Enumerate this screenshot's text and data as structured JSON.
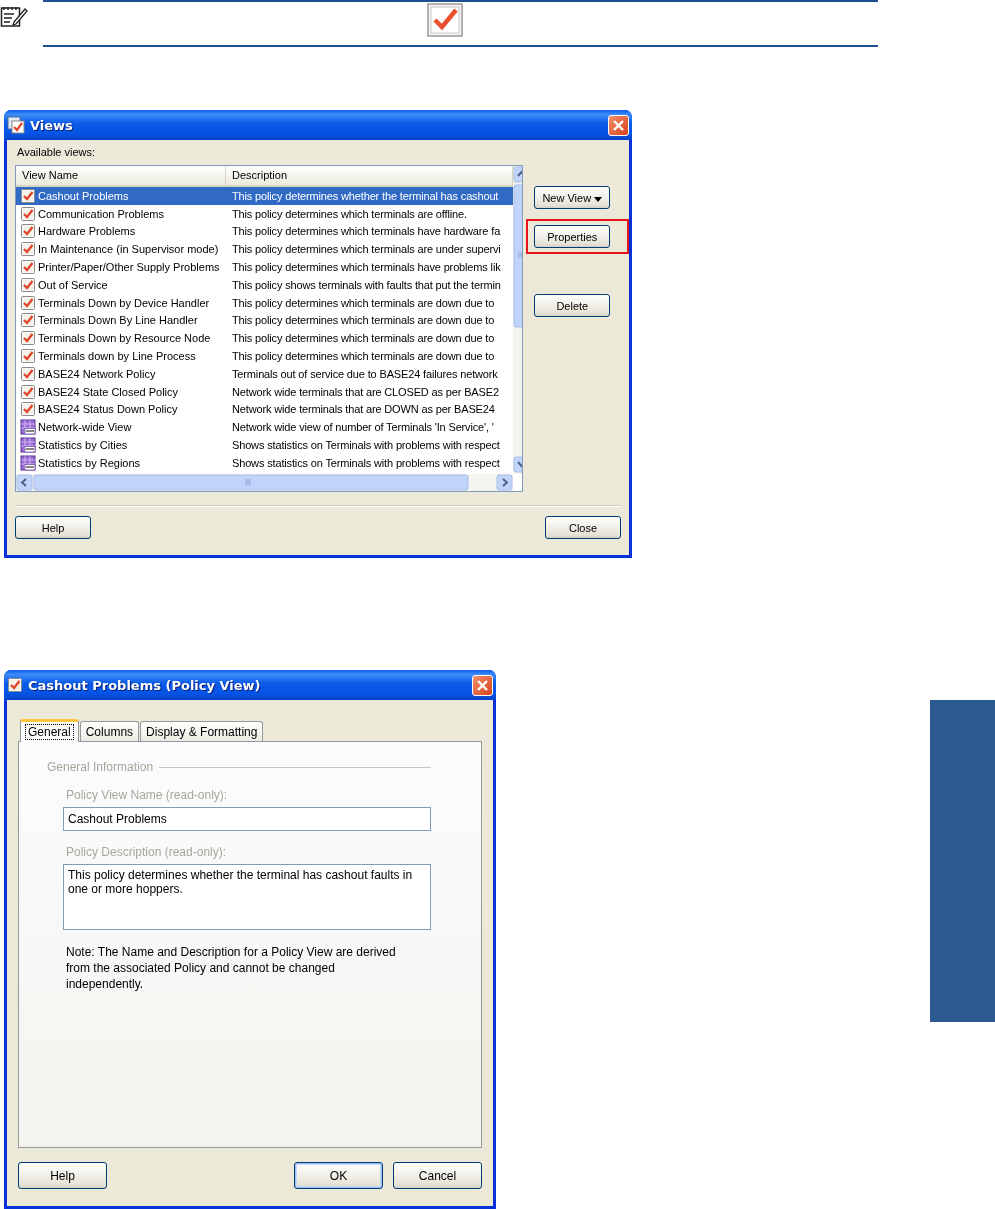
{
  "views_dialog": {
    "title": "Views",
    "list_label": "Available views:",
    "columns": [
      "View Name",
      "Description"
    ],
    "rows": [
      {
        "name": "Cashout Problems",
        "description": "This policy determines whether the terminal has cashout",
        "kind": "policy",
        "selected": true
      },
      {
        "name": "Communication Problems",
        "description": "This policy determines which terminals are offline.",
        "kind": "policy",
        "selected": false
      },
      {
        "name": "Hardware Problems",
        "description": "This policy determines which terminals have hardware fa",
        "kind": "policy",
        "selected": false
      },
      {
        "name": "In Maintenance (in Supervisor mode)",
        "description": "This policy determines which terminals are under supervi",
        "kind": "policy",
        "selected": false
      },
      {
        "name": "Printer/Paper/Other Supply Problems",
        "description": "This policy determines which terminals have problems lik",
        "kind": "policy",
        "selected": false
      },
      {
        "name": "Out of Service",
        "description": "This policy shows terminals with faults that put the termin",
        "kind": "policy",
        "selected": false
      },
      {
        "name": "Terminals Down by Device Handler",
        "description": "This policy determines which terminals are down due to",
        "kind": "policy",
        "selected": false
      },
      {
        "name": "Terminals Down By Line Handler",
        "description": "This policy determines which terminals are down due to",
        "kind": "policy",
        "selected": false
      },
      {
        "name": "Terminals Down by Resource Node",
        "description": "This policy determines which terminals are down due to",
        "kind": "policy",
        "selected": false
      },
      {
        "name": "Terminals down by Line Process",
        "description": "This policy determines which terminals are down due to",
        "kind": "policy",
        "selected": false
      },
      {
        "name": "BASE24 Network Policy",
        "description": "Terminals out of service due to BASE24 failures network",
        "kind": "policy",
        "selected": false
      },
      {
        "name": "BASE24 State Closed Policy",
        "description": "Network wide terminals that are CLOSED as per BASE2",
        "kind": "policy",
        "selected": false
      },
      {
        "name": "BASE24 Status Down Policy",
        "description": "Network wide terminals that are DOWN as per BASE24",
        "kind": "policy",
        "selected": false
      },
      {
        "name": "Network-wide View",
        "description": "Network wide view of number of Terminals 'In Service', '",
        "kind": "sql",
        "selected": false
      },
      {
        "name": "Statistics by Cities",
        "description": "Shows statistics on Terminals with problems with respect",
        "kind": "sql",
        "selected": false
      },
      {
        "name": "Statistics by Regions",
        "description": "Shows statistics on Terminals with problems with respect",
        "kind": "sql",
        "selected": false
      }
    ],
    "side_buttons": [
      {
        "label": "New View",
        "kind": "menu",
        "highlighted": false
      },
      {
        "label": "Properties",
        "kind": "push",
        "highlighted": true
      },
      {
        "label": "Delete",
        "kind": "push",
        "highlighted": false
      }
    ],
    "footer_left": [
      "Help"
    ],
    "footer_right": [
      "Close"
    ]
  },
  "policy_dialog": {
    "title": "Cashout Problems (Policy View)",
    "tabs": [
      {
        "label": "General",
        "selected": true
      },
      {
        "label": "Columns",
        "selected": false
      },
      {
        "label": "Display & Formatting",
        "selected": false
      }
    ],
    "group": "General Information",
    "fields": [
      {
        "label": "Policy View Name (read-only):",
        "value": "Cashout Problems",
        "kind": "line"
      },
      {
        "label": "Policy Description (read-only):",
        "value": "This policy determines whether the terminal has cashout faults in one or more hoppers.",
        "kind": "multiline"
      }
    ],
    "note": "Note: The Name and Description for a Policy View are derived from the associated Policy and cannot be changed independently.",
    "footer_left": [
      {
        "label": "Help",
        "default": false
      }
    ],
    "footer_right": [
      {
        "label": "OK",
        "default": true
      },
      {
        "label": "Cancel",
        "default": false
      }
    ]
  }
}
